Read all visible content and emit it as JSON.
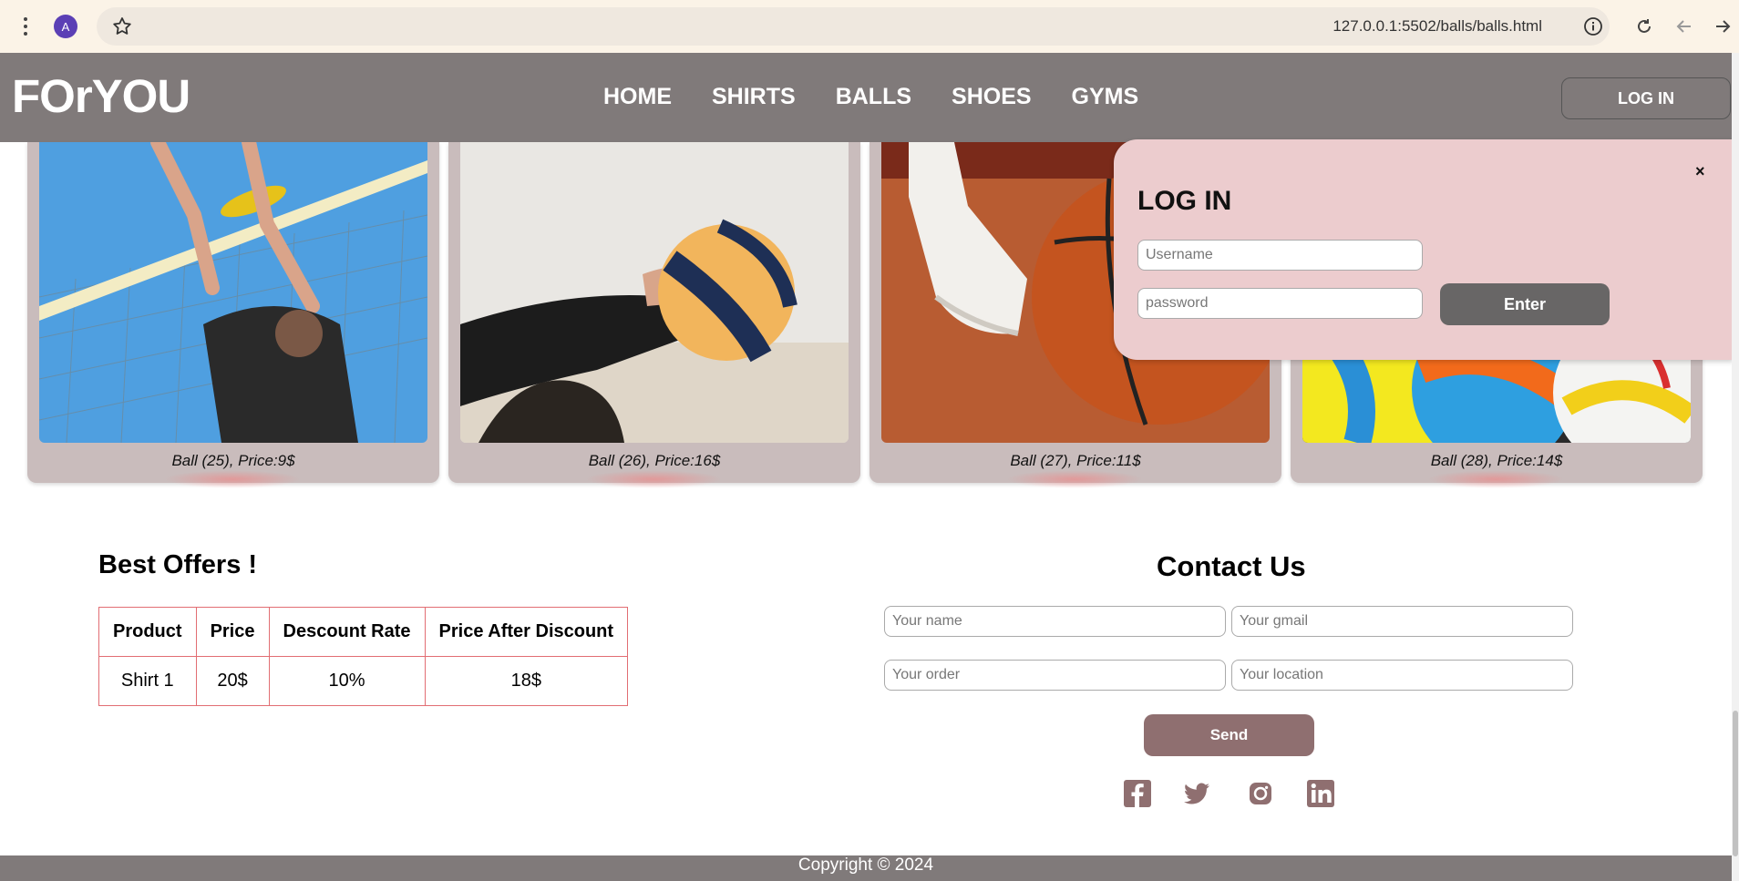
{
  "browser": {
    "profile_initial": "A",
    "url": "127.0.0.1:5502/balls/balls.html"
  },
  "header": {
    "logo": "FOrYOU",
    "nav": [
      "HOME",
      "SHIRTS",
      "BALLS",
      "SHOES",
      "GYMS"
    ],
    "login_label": "LOG IN"
  },
  "products": [
    {
      "caption": "Ball (25), Price:9$"
    },
    {
      "caption": "Ball (26), Price:16$"
    },
    {
      "caption": "Ball (27), Price:11$"
    },
    {
      "caption": "Ball (28), Price:14$"
    }
  ],
  "login_popup": {
    "close": "×",
    "title": "LOG IN",
    "username_placeholder": "Username",
    "password_placeholder": "password",
    "enter_label": "Enter"
  },
  "offers": {
    "title": "Best Offers !",
    "headers": [
      "Product",
      "Price",
      "Descount Rate",
      "Price After Discount"
    ],
    "rows": [
      [
        "Shirt 1",
        "20$",
        "10%",
        "18$"
      ]
    ]
  },
  "contact": {
    "title": "Contact Us",
    "name_placeholder": "Your name",
    "gmail_placeholder": "Your gmail",
    "order_placeholder": "Your order",
    "location_placeholder": "Your location",
    "send_label": "Send",
    "social_icons": [
      "facebook-icon",
      "twitter-icon",
      "instagram-icon",
      "linkedin-icon"
    ]
  },
  "footer": {
    "copyright": "Copyright © 2024"
  },
  "colors": {
    "header_bg": "#807a7a",
    "card_bg": "#c9bcbc",
    "popup_bg": "#ecccce",
    "accent": "#8f6f70",
    "table_border": "#e26e73"
  }
}
